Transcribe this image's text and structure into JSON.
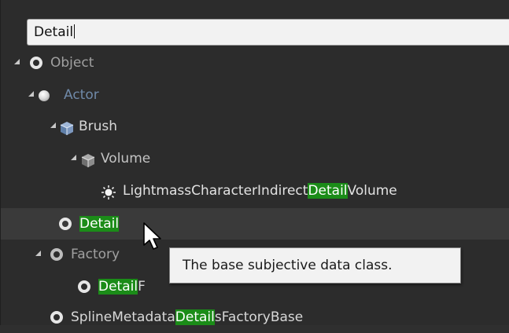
{
  "search": {
    "value": "Detail"
  },
  "tree": {
    "object": {
      "label": "Object"
    },
    "actor": {
      "label": "Actor"
    },
    "brush": {
      "label": "Brush"
    },
    "volume": {
      "label": "Volume"
    },
    "lightmass": {
      "pre": "LightmassCharacterIndirect",
      "match": "Detail",
      "post": "Volume"
    },
    "detail": {
      "match": "Detail"
    },
    "factory": {
      "label": "Factory"
    },
    "detail_factory": {
      "match": "Detail",
      "post": "F"
    },
    "spline": {
      "pre": "SplineMetadata",
      "match": "Detail",
      "post": "sFactoryBase"
    }
  },
  "tooltip": {
    "text": "The base subjective data class."
  },
  "colors": {
    "background": "#2c2c2c",
    "highlight": "#1b8c18",
    "hover_row": "#3a3a3a",
    "tooltip_bg": "#f2f2f2"
  },
  "icons": {
    "class_icon": "circle-ring-icon",
    "actor_icon": "sphere-icon",
    "brush_icon": "cube-icon",
    "light_icon": "light-bulb-icon",
    "expand_icon": "expanded-arrow-icon",
    "cursor": "mouse-pointer-icon"
  }
}
